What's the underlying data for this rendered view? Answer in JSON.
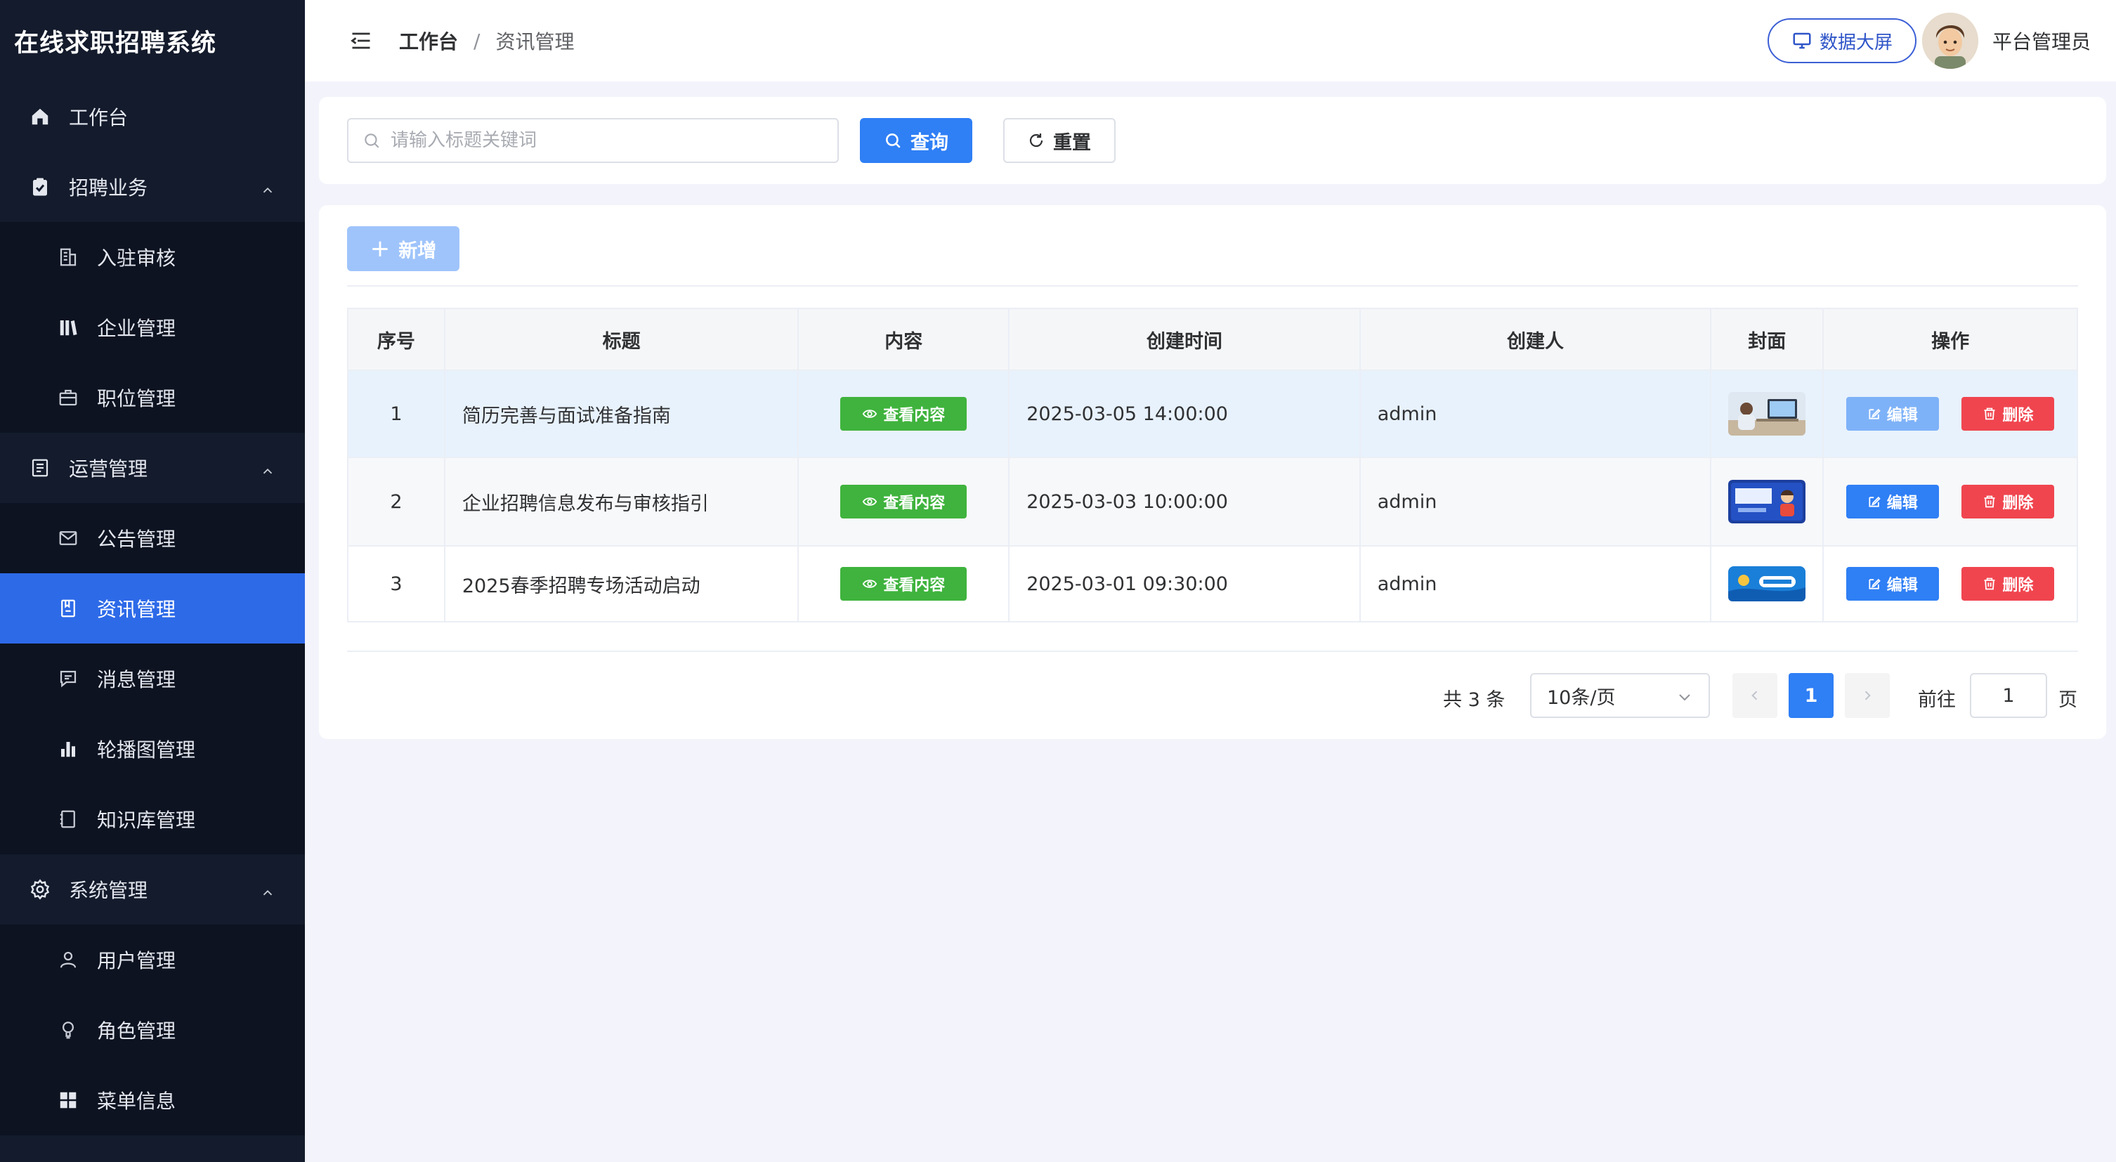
{
  "app": {
    "title": "在线求职招聘系统"
  },
  "sidebar": {
    "items": [
      {
        "label": "工作台",
        "icon": "home-icon"
      },
      {
        "label": "招聘业务",
        "icon": "clipboard-check-icon"
      },
      {
        "label": "入驻审核",
        "icon": "building-icon"
      },
      {
        "label": "企业管理",
        "icon": "library-icon"
      },
      {
        "label": "职位管理",
        "icon": "briefcase-icon"
      },
      {
        "label": "运营管理",
        "icon": "document-icon"
      },
      {
        "label": "公告管理",
        "icon": "mail-icon"
      },
      {
        "label": "资讯管理",
        "icon": "notebook-icon"
      },
      {
        "label": "消息管理",
        "icon": "chat-icon"
      },
      {
        "label": "轮播图管理",
        "icon": "bar-chart-icon"
      },
      {
        "label": "知识库管理",
        "icon": "book-icon"
      },
      {
        "label": "系统管理",
        "icon": "gear-icon"
      },
      {
        "label": "用户管理",
        "icon": "user-icon"
      },
      {
        "label": "角色管理",
        "icon": "lightbulb-icon"
      },
      {
        "label": "菜单信息",
        "icon": "grid-icon"
      }
    ]
  },
  "header": {
    "breadcrumb": [
      "工作台",
      "资讯管理"
    ],
    "screen_button": "数据大屏",
    "username": "平台管理员"
  },
  "search": {
    "placeholder": "请输入标题关键词",
    "value": "",
    "query_label": "查询",
    "reset_label": "重置"
  },
  "toolbar": {
    "add_label": "新增"
  },
  "table": {
    "columns": [
      "序号",
      "标题",
      "内容",
      "创建时间",
      "创建人",
      "封面",
      "操作"
    ],
    "view_label": "查看内容",
    "edit_label": "编辑",
    "delete_label": "删除",
    "rows": [
      {
        "index": "1",
        "title": "简历完善与面试准备指南",
        "created_at": "2025-03-05 14:00:00",
        "creator": "admin"
      },
      {
        "index": "2",
        "title": "企业招聘信息发布与审核指引",
        "created_at": "2025-03-03 10:00:00",
        "creator": "admin"
      },
      {
        "index": "3",
        "title": "2025春季招聘专场活动启动",
        "created_at": "2025-03-01 09:30:00",
        "creator": "admin"
      }
    ]
  },
  "pagination": {
    "total": "共 3 条",
    "page_size": "10条/页",
    "current_page": "1",
    "goto_label": "前往",
    "goto_value": "1",
    "page_suffix": "页"
  },
  "colors": {
    "sidebar_bg": "#131b2c",
    "active": "#2d6ae8",
    "primary": "#2f7ff5",
    "success": "#3fb33d",
    "danger": "#f0454f"
  }
}
